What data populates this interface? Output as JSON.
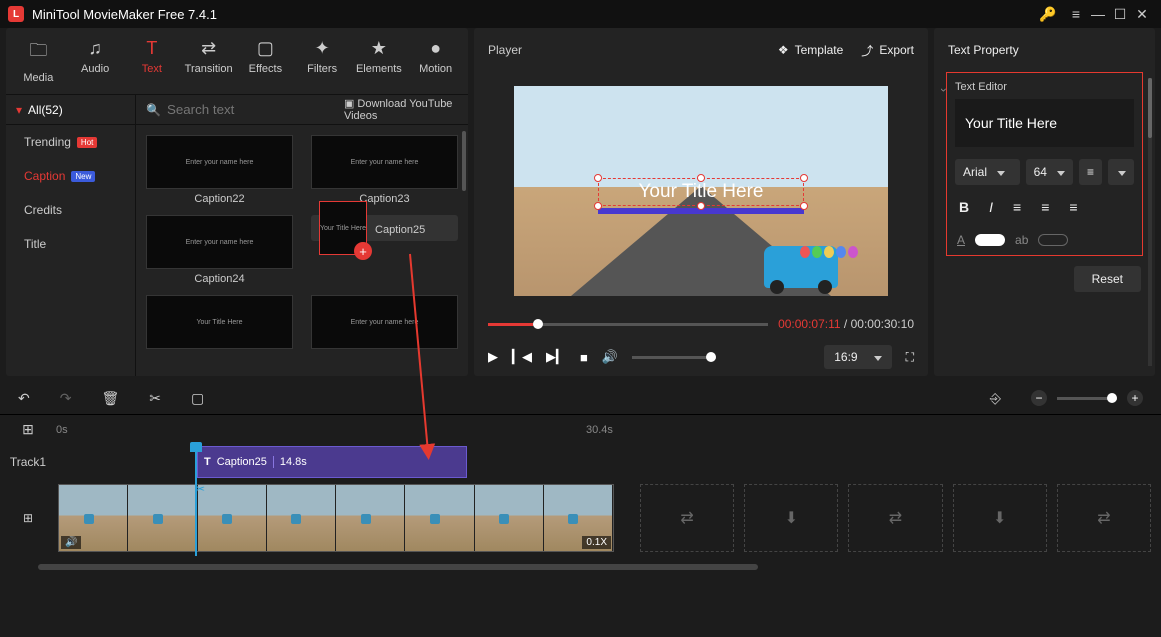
{
  "app": {
    "title": "MiniTool MovieMaker Free 7.4.1"
  },
  "toolbar": [
    {
      "icon": "🗀",
      "label": "Media"
    },
    {
      "icon": "♫",
      "label": "Audio"
    },
    {
      "icon": "T",
      "label": "Text",
      "active": true
    },
    {
      "icon": "⇄",
      "label": "Transition"
    },
    {
      "icon": "▢",
      "label": "Effects"
    },
    {
      "icon": "✦",
      "label": "Filters"
    },
    {
      "icon": "★",
      "label": "Elements"
    },
    {
      "icon": "●",
      "label": "Motion"
    }
  ],
  "sidebar": {
    "head": "All(52)",
    "items": [
      {
        "label": "Trending",
        "badge": "Hot",
        "badgeClass": "hot"
      },
      {
        "label": "Caption",
        "badge": "New",
        "badgeClass": "new",
        "active": true
      },
      {
        "label": "Credits"
      },
      {
        "label": "Title"
      }
    ]
  },
  "search": {
    "placeholder": "Search text",
    "download": "Download YouTube Videos"
  },
  "thumbs": [
    {
      "label": "Caption22",
      "text": "Enter your name here"
    },
    {
      "label": "Caption23",
      "text": "Enter your name here"
    },
    {
      "label": "Caption24",
      "text": "Enter your name here"
    },
    {
      "label": "Caption25",
      "text": "Your Title Here",
      "selected": true,
      "add": true
    },
    {
      "label": "",
      "text": "Your Title Here"
    },
    {
      "label": "",
      "text": "Enter your name here"
    }
  ],
  "player": {
    "title": "Player",
    "template": "Template",
    "export": "Export",
    "overlayText": "Your Title Here",
    "time_current": "00:00:07:11",
    "time_total": "00:00:30:10",
    "ratio": "16:9"
  },
  "textprop": {
    "title": "Text Property",
    "sublabel": "Text Editor",
    "content": "Your Title Here",
    "font": "Arial",
    "size": "64",
    "reset": "Reset"
  },
  "timeline": {
    "t0": "0s",
    "t1": "30.4s",
    "track1_label": "Track1",
    "clip_name": "Caption25",
    "clip_dur": "14.8s",
    "speed": "0.1X"
  }
}
